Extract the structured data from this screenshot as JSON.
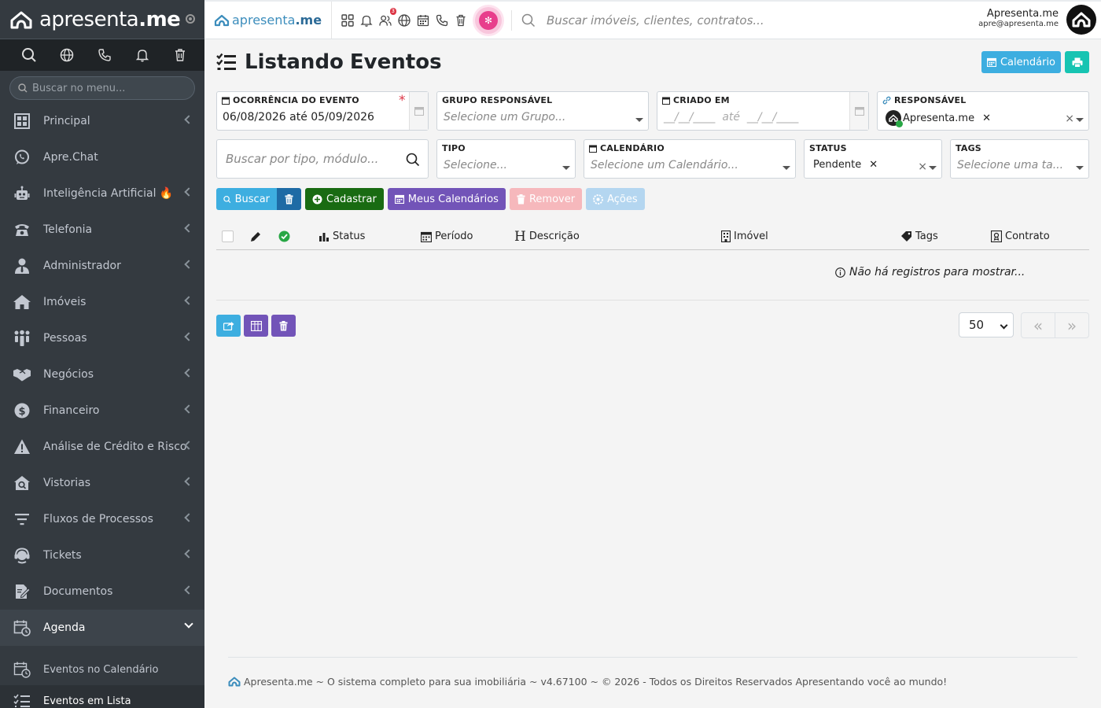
{
  "sidebar": {
    "logo_light": "apresenta",
    "logo_bold": ".me",
    "search_placeholder": "Buscar no menu...",
    "items": [
      {
        "label": "Principal",
        "icon": "dashboard-icon"
      },
      {
        "label": "Apre.Chat",
        "icon": "whatsapp-icon"
      },
      {
        "label": "Inteligência Artificial 🔥",
        "icon": "robot-icon"
      },
      {
        "label": "Telefonia",
        "icon": "phone-icon"
      },
      {
        "label": "Administrador",
        "icon": "user-tie-icon"
      },
      {
        "label": "Imóveis",
        "icon": "home-icon"
      },
      {
        "label": "Pessoas",
        "icon": "people-icon"
      },
      {
        "label": "Negócios",
        "icon": "handshake-icon"
      },
      {
        "label": "Financeiro",
        "icon": "dollar-icon"
      },
      {
        "label": "Análise de Crédito e Risco",
        "icon": "warning-icon"
      },
      {
        "label": "Vistorias",
        "icon": "house-search-icon"
      },
      {
        "label": "Fluxos de Processos",
        "icon": "filter-icon"
      },
      {
        "label": "Tickets",
        "icon": "headset-icon"
      },
      {
        "label": "Documentos",
        "icon": "document-edit-icon"
      },
      {
        "label": "Agenda",
        "icon": "calendar-clock-icon"
      }
    ],
    "subitems": [
      {
        "label": "Eventos no Calendário",
        "icon": "calendar-clock-icon"
      },
      {
        "label": "Eventos em Lista",
        "icon": "list-check-icon"
      }
    ]
  },
  "topbar": {
    "brand_light": "apresenta",
    "brand_bold": ".me",
    "notification_badge": "3",
    "search_placeholder": "Buscar imóveis, clientes, contratos...",
    "user_name": "Apresenta.me",
    "user_email": "apre@apresenta.me"
  },
  "page": {
    "title_light": "Listando",
    "title_bold": "Eventos",
    "calendar_button": "Calendário"
  },
  "filters": {
    "ocorrencia": {
      "label": "OCORRÊNCIA DO EVENTO",
      "value": "06/08/2026 até 05/09/2026",
      "required_mark": "*"
    },
    "grupo": {
      "label": "GRUPO RESPONSÁVEL",
      "placeholder": "Selecione um Grupo..."
    },
    "criado": {
      "label": "CRIADO EM",
      "placeholder": "__/__/____  até  __/__/____"
    },
    "responsavel": {
      "label": "RESPONSÁVEL",
      "chip": "Apresenta.me"
    },
    "busca": {
      "placeholder": "Buscar por tipo, módulo..."
    },
    "tipo": {
      "label": "TIPO",
      "placeholder": "Selecione..."
    },
    "calendario": {
      "label": "CALENDÁRIO",
      "placeholder": "Selecione um Calendário..."
    },
    "status": {
      "label": "STATUS",
      "chip": "Pendente"
    },
    "tags": {
      "label": "TAGS",
      "placeholder": "Selecione uma ta..."
    }
  },
  "actions": {
    "search": "Buscar",
    "create": "Cadastrar",
    "my_calendars": "Meus Calendários",
    "remove": "Remover",
    "actions": "Ações"
  },
  "colors": {
    "primary": "#3daee0",
    "success": "#196b12",
    "purple": "#7254b8",
    "sidebar_bg": "#343a40"
  },
  "table": {
    "columns": [
      "Status",
      "Período",
      "Descrição",
      "Imóvel",
      "Tags",
      "Contrato"
    ],
    "empty_message": "Não há registros para mostrar..."
  },
  "pagination": {
    "per_page": "50",
    "first": "«",
    "last": "»"
  },
  "footer": {
    "text": "Apresenta.me ~ O sistema completo para sua imobiliária ~ v4.67100 ~ © 2026 - Todos os Direitos Reservados Apresentando você ao mundo!"
  }
}
